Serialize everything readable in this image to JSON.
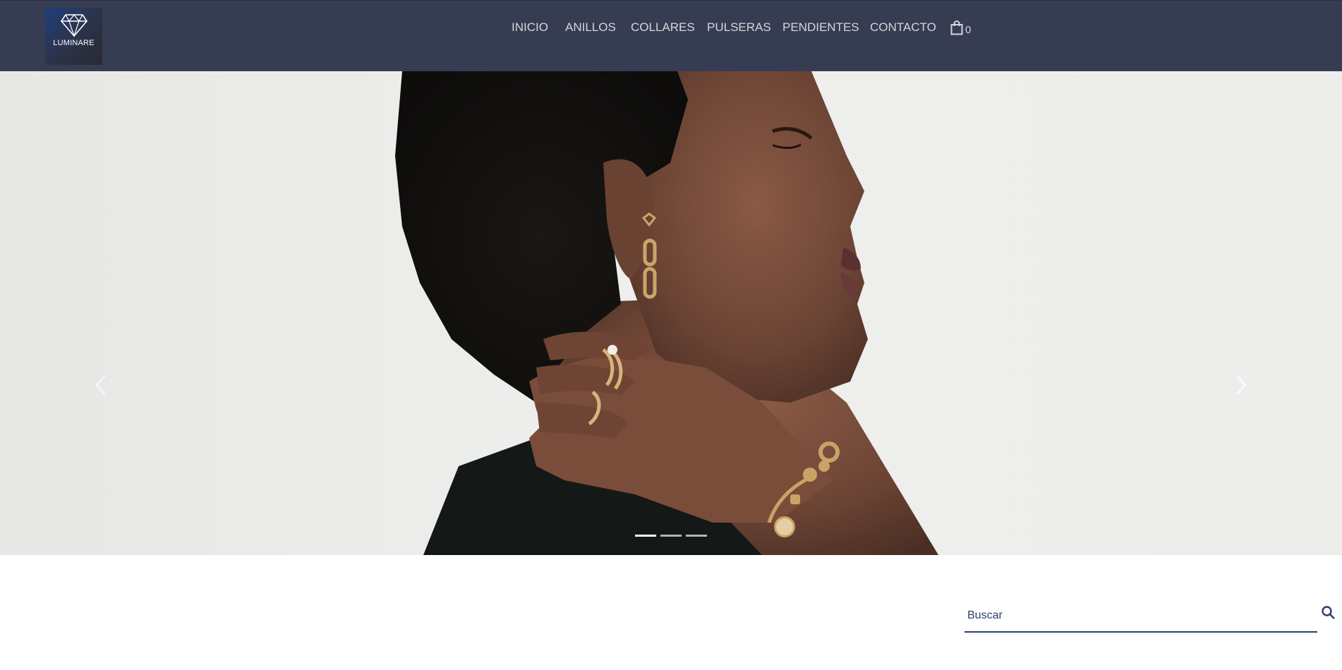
{
  "brand": {
    "name": "LUMINARE"
  },
  "nav": {
    "items": [
      {
        "label": "INICIO"
      },
      {
        "label": "ANILLOS"
      },
      {
        "label": "COLLARES"
      },
      {
        "label": "PULSERAS"
      },
      {
        "label": "PENDIENTES"
      },
      {
        "label": "CONTACTO"
      }
    ],
    "cart_count": "0"
  },
  "carousel": {
    "slide_count": 3,
    "active_index": 0
  },
  "search": {
    "placeholder": "Buscar"
  },
  "colors": {
    "header_bg": "#363d52",
    "nav_text": "#d4d6dc",
    "accent": "#2f3f69"
  }
}
